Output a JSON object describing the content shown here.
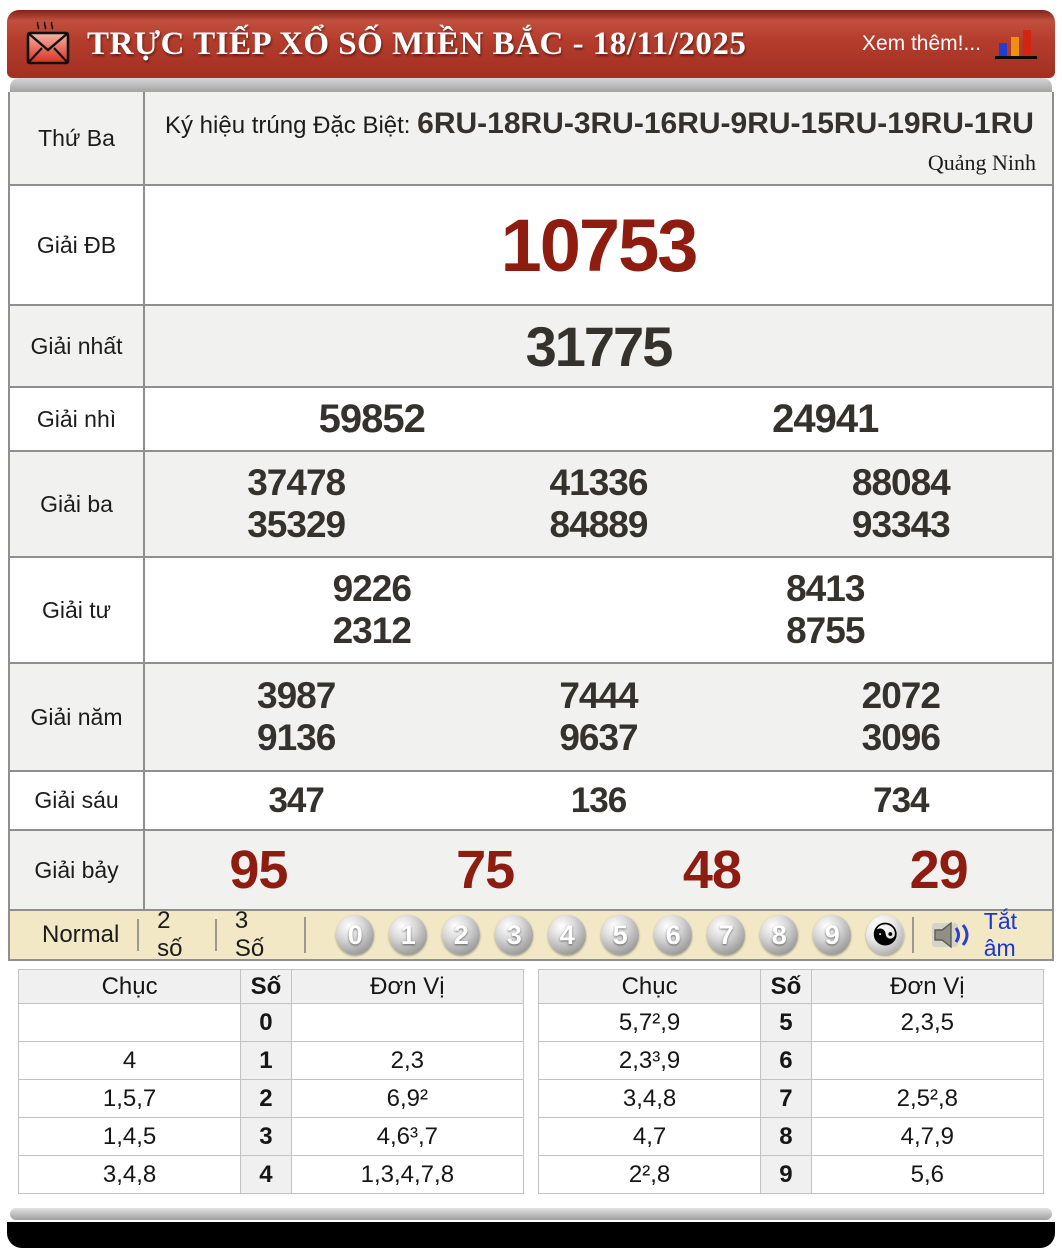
{
  "colors": {
    "accent-red": "#8e1c10",
    "header-red": "#a93327",
    "cream": "#f2e8c6",
    "link-blue": "#1a36cc"
  },
  "header": {
    "title": "TRỰC TIẾP XỔ SỐ MIỀN BẮC - 18/11/2025",
    "more_label": "Xem thêm!..."
  },
  "sign_row": {
    "day": "Thứ Ba",
    "label": "Ký hiệu trúng Đặc Biệt: ",
    "codes": "6RU-18RU-3RU-16RU-9RU-15RU-19RU-1RU",
    "province": "Quảng Ninh"
  },
  "prizes": [
    {
      "label": "Giải ĐB",
      "rows": [
        [
          "10753"
        ]
      ]
    },
    {
      "label": "Giải nhất",
      "rows": [
        [
          "31775"
        ]
      ]
    },
    {
      "label": "Giải nhì",
      "rows": [
        [
          "59852",
          "24941"
        ]
      ]
    },
    {
      "label": "Giải ba",
      "rows": [
        [
          "37478",
          "41336",
          "88084"
        ],
        [
          "35329",
          "84889",
          "93343"
        ]
      ]
    },
    {
      "label": "Giải tư",
      "rows": [
        [
          "9226",
          "8413"
        ],
        [
          "2312",
          "8755"
        ]
      ]
    },
    {
      "label": "Giải năm",
      "rows": [
        [
          "3987",
          "7444",
          "2072"
        ],
        [
          "9136",
          "9637",
          "3096"
        ]
      ]
    },
    {
      "label": "Giải sáu",
      "rows": [
        [
          "347",
          "136",
          "734"
        ]
      ]
    },
    {
      "label": "Giải bảy",
      "rows": [
        [
          "95",
          "75",
          "48",
          "29"
        ]
      ]
    }
  ],
  "controls": {
    "modes": [
      "Normal",
      "2 số",
      "3 Số"
    ],
    "balls": [
      "0",
      "1",
      "2",
      "3",
      "4",
      "5",
      "6",
      "7",
      "8",
      "9"
    ],
    "yinyang": "☯",
    "mute_label": "Tắt âm"
  },
  "head_tail": {
    "headers": {
      "chuc": "Chục",
      "so": "Số",
      "donvi": "Đơn Vị"
    },
    "left": [
      {
        "chuc": "",
        "so": "0",
        "donvi": ""
      },
      {
        "chuc": "4",
        "so": "1",
        "donvi": "2,3"
      },
      {
        "chuc": "1,5,7",
        "so": "2",
        "donvi": "6,9²"
      },
      {
        "chuc": "1,4,5",
        "so": "3",
        "donvi": "4,6³,7"
      },
      {
        "chuc": "3,4,8",
        "so": "4",
        "donvi": "1,3,4,7,8"
      }
    ],
    "right": [
      {
        "chuc": "5,7²,9",
        "so": "5",
        "donvi": "2,3,5"
      },
      {
        "chuc": "2,3³,9",
        "so": "6",
        "donvi": ""
      },
      {
        "chuc": "3,4,8",
        "so": "7",
        "donvi": "2,5²,8"
      },
      {
        "chuc": "4,7",
        "so": "8",
        "donvi": "4,7,9"
      },
      {
        "chuc": "2²,8",
        "so": "9",
        "donvi": "5,6"
      }
    ]
  }
}
